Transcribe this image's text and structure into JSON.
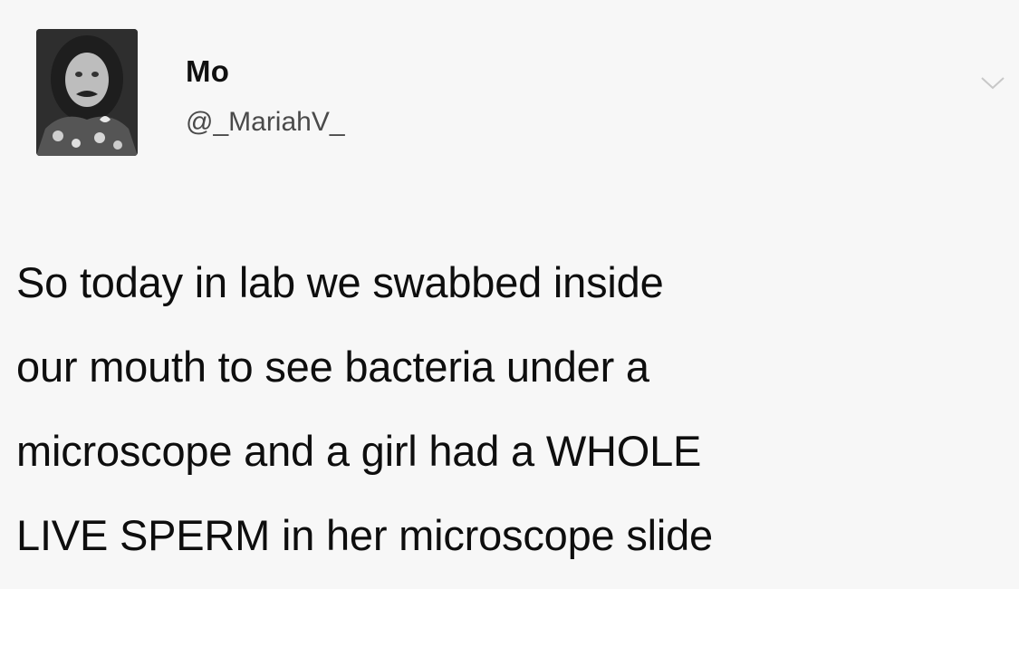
{
  "tweet": {
    "author": {
      "display_name": "Mo",
      "handle": "@_MariahV_",
      "avatar_icon": "profile-photo"
    },
    "menu_icon": "chevron-down-icon",
    "text_lines": [
      "So today in lab we swabbed inside",
      "our mouth to see bacteria under a",
      "microscope and a girl had a WHOLE",
      "LIVE SPERM in her microscope slide"
    ]
  },
  "colors": {
    "card_background": "#f7f7f7",
    "page_background": "#ffffff",
    "text": "#0e0e0e",
    "handle": "#4a4a4a",
    "caret": "#c8c8c8"
  }
}
